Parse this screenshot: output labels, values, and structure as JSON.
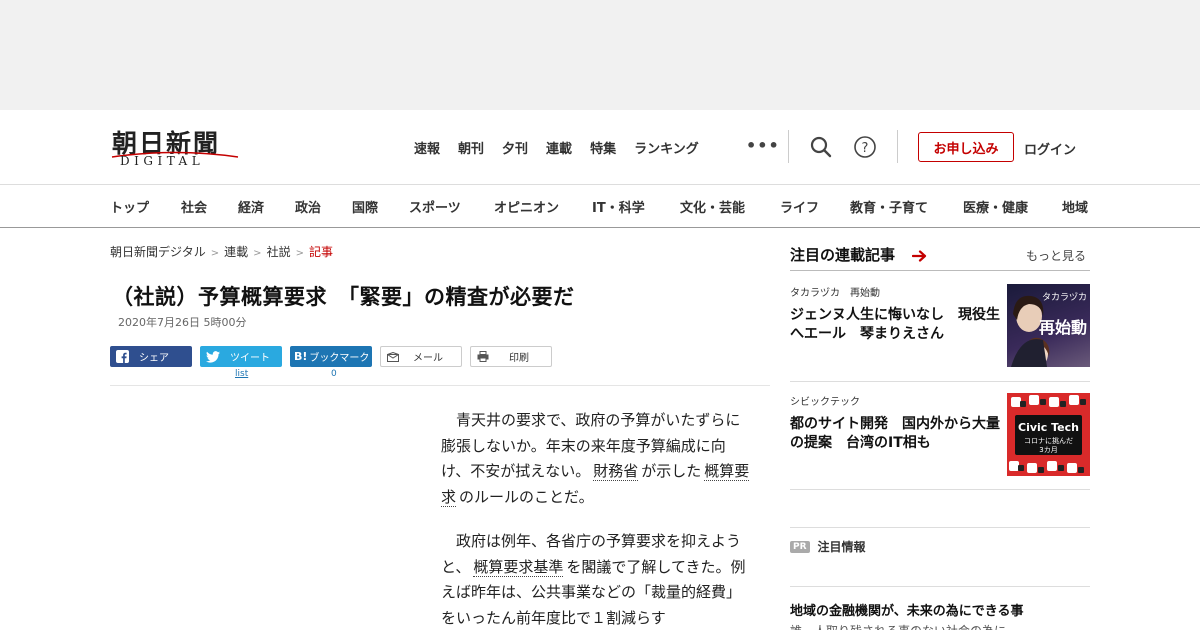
{
  "logo": {
    "kanji": "朝日新聞",
    "sub": "DIGITAL"
  },
  "topnav": [
    "速報",
    "朝刊",
    "夕刊",
    "連載",
    "特集",
    "ランキング"
  ],
  "more_dots": "•••",
  "header_buttons": {
    "apply": "お申し込み",
    "login": "ログイン"
  },
  "categories": [
    "トップ",
    "社会",
    "経済",
    "政治",
    "国際",
    "スポーツ",
    "オピニオン",
    "IT・科学",
    "文化・芸能",
    "ライフ",
    "教育・子育て",
    "医療・健康",
    "地域"
  ],
  "breadcrumb": [
    "朝日新聞デジタル",
    "連載",
    "社説",
    "記事"
  ],
  "article": {
    "title": "（社説）予算概算要求　「緊要」の精査が必要だ",
    "date": "2020年7月26日 5時00分",
    "paragraphs": [
      {
        "before": "青天井の要求で、政府の予算がいたずらに膨張しないか。年末の来年度予算編成に向け、不安が拭えない。",
        "kw1": "財務省",
        "middle": "が示した",
        "kw2": "概算要求",
        "after": "のルールのことだ。"
      },
      {
        "before": "政府は例年、各省庁の予算要求を抑えようと、",
        "kw1": "概算要求基準",
        "after": "を閣議で了解してきた。例えば昨年は、公共事業などの「裁量的経費」をいったん前年度比で１割減らす"
      }
    ]
  },
  "share": {
    "facebook": "シェア",
    "twitter": "ツイート",
    "twitter_count": "list",
    "hatena": "ブックマーク",
    "hatena_count": "0",
    "mail": "メール",
    "print": "印刷"
  },
  "sidebar": {
    "heading": "注目の連載記事",
    "more": "もっと見る",
    "items": [
      {
        "category": "タカラヅカ　再始動",
        "title": "ジェンヌ人生に悔いなし　現役生へエール　琴まりえさん",
        "thumb_text": "再始動",
        "thumb_top": "タカラヅカ"
      },
      {
        "category": "シビックテック",
        "title": "都のサイト開発　国内外から大量の提案　台湾のIT相も",
        "thumb_text": "Civic Tech",
        "thumb_sub": "コロナに挑んだ 3カ月"
      }
    ],
    "pr_badge": "PR",
    "pr_label": "注目情報",
    "pr_title": "地域の金融機関が、未来の為にできる事",
    "pr_desc": "誰一人取り残される事のない社会の為に"
  },
  "colors": {
    "accent": "#c40000",
    "facebook": "#2f4f8f",
    "twitter": "#2aa9e0",
    "hatena": "#1d75b3"
  }
}
